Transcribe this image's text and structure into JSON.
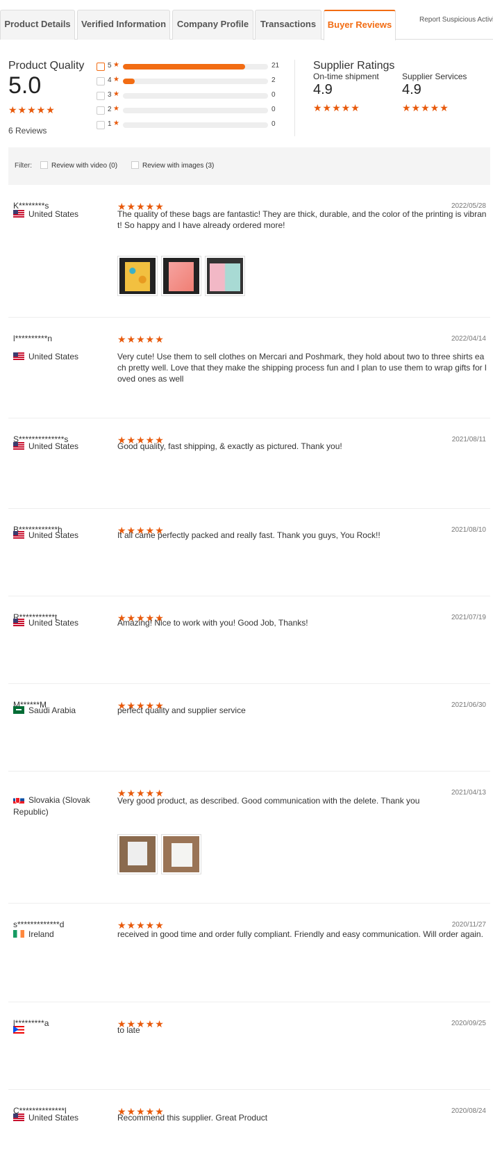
{
  "tabs": [
    {
      "label": "Product Details",
      "active": false
    },
    {
      "label": "Verified Information",
      "active": false
    },
    {
      "label": "Company Profile",
      "active": false
    },
    {
      "label": "Transactions",
      "active": false
    },
    {
      "label": "Buyer Reviews",
      "active": true
    }
  ],
  "report_link": "Report Suspicious Activity",
  "product_quality": {
    "title": "Product Quality",
    "score": "5.0",
    "stars": "★★★★★",
    "reviews_count": "6 Reviews",
    "breakdown": [
      {
        "stars": "5",
        "count": "21",
        "fraction": 0.84,
        "checked": true
      },
      {
        "stars": "4",
        "count": "2",
        "fraction": 0.08,
        "checked": false
      },
      {
        "stars": "3",
        "count": "0",
        "fraction": 0,
        "checked": false
      },
      {
        "stars": "2",
        "count": "0",
        "fraction": 0,
        "checked": false
      },
      {
        "stars": "1",
        "count": "0",
        "fraction": 0,
        "checked": false
      }
    ]
  },
  "supplier_ratings": {
    "title": "Supplier Ratings",
    "items": [
      {
        "label": "On-time shipment",
        "score": "4.9",
        "stars": "★★★★★"
      },
      {
        "label": "Supplier Services",
        "score": "4.9",
        "stars": "★★★★★"
      }
    ]
  },
  "filter": {
    "label": "Filter:",
    "options": [
      "Review with video (0)",
      "Review with images (3)"
    ]
  },
  "star_glyph": "★",
  "accent_color": "#f26c13",
  "reviews": [
    {
      "name": "K********s",
      "country": "United States",
      "flag": "us",
      "stars": "★★★★★",
      "date": "2022/05/28",
      "text": "The quality of these bags are fantastic! They are thick, durable, and the color of the printing is vibrant! So happy and I have already ordered more!",
      "images": [
        "t1",
        "t2",
        "t3"
      ]
    },
    {
      "name": "l**********n",
      "country": "United States",
      "flag": "us",
      "stars": "★★★★★",
      "date": "2022/04/14",
      "text": "Very cute! Use them to sell clothes on Mercari and Poshmark, they hold about two to three shirts each pretty well. Love that they make the shipping process fun and I plan to use them to wrap gifts for loved ones as well",
      "images": []
    },
    {
      "name": "S**************s",
      "country": "United States",
      "flag": "us",
      "stars": "★★★★★",
      "date": "2021/08/11",
      "text": "Good quality, fast shipping, & exactly as pictured. Thank you!",
      "images": []
    },
    {
      "name": "B************h",
      "country": "United States",
      "flag": "us",
      "stars": "★★★★★",
      "date": "2021/08/10",
      "text": "It all came perfectly packed and really fast. Thank you guys, You Rock!!",
      "images": []
    },
    {
      "name": "R***********t",
      "country": "United States",
      "flag": "us",
      "stars": "★★★★★",
      "date": "2021/07/19",
      "text": "Amazing! Nice to work with you! Good Job, Thanks!",
      "images": []
    },
    {
      "name": "M******M",
      "country": "Saudi Arabia",
      "flag": "sa",
      "stars": "★★★★★",
      "date": "2021/06/30",
      "text": "perfect quality and supplier service",
      "images": []
    },
    {
      "name": "",
      "country": "Slovakia (Slovak Republic)",
      "flag": "sk",
      "stars": "★★★★★",
      "date": "2021/04/13",
      "text": "Very good product, as described. Good communication with the delete. Thank you",
      "images": [
        "t4",
        "t5"
      ]
    },
    {
      "name": "s*************d",
      "country": "Ireland",
      "flag": "ie",
      "stars": "★★★★★",
      "date": "2020/11/27",
      "text": "received in good time and order fully compliant. Friendly and easy communication. Will order again.",
      "images": []
    },
    {
      "name": "l*********a",
      "country": "",
      "flag": "pr",
      "stars": "★★★★★",
      "date": "2020/09/25",
      "text": "to late",
      "images": []
    },
    {
      "name": "C**************l",
      "country": "United States",
      "flag": "us",
      "stars": "★★★★★",
      "date": "2020/08/24",
      "text": "Recommend this supplier. Great Product",
      "images": []
    }
  ]
}
